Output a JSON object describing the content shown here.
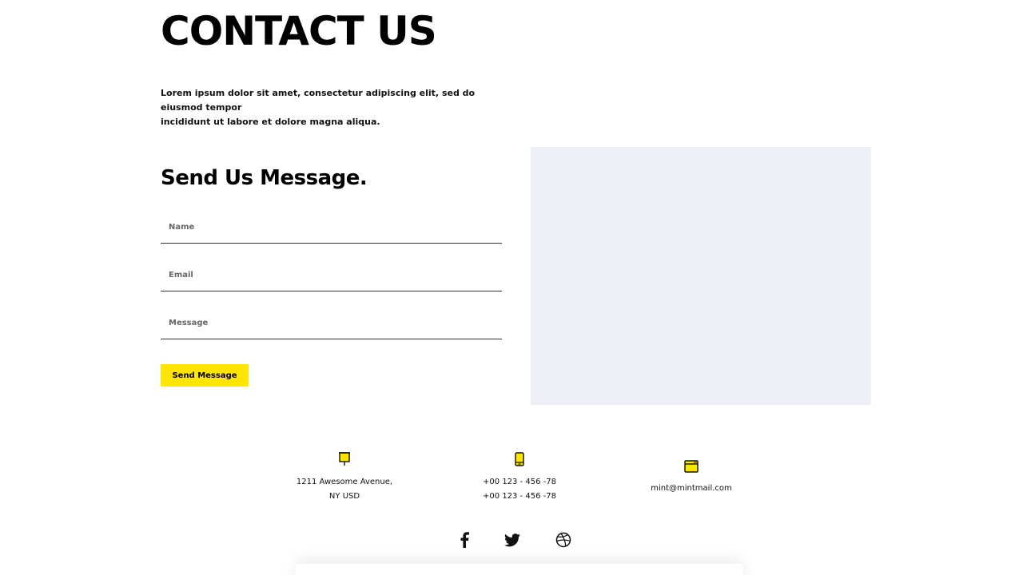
{
  "header": {
    "title": "CONTACT US",
    "intro_line1": "Lorem ipsum dolor sit amet, consectetur adipiscing elit, sed do eiusmod tempor",
    "intro_line2": "incididunt ut labore et dolore magna aliqua."
  },
  "form": {
    "heading": "Send Us Message.",
    "name_placeholder": "Name",
    "email_placeholder": "Email",
    "message_placeholder": "Message",
    "submit_label": "Send Message"
  },
  "contact_info": {
    "address_line1": "1211 Awesome Avenue,",
    "address_line2": "NY USD",
    "phone_line1": "+00 123 - 456 -78",
    "phone_line2": "+00 123 - 456 -78",
    "email": "mint@mintmail.com",
    "address_icon": "signpost-icon",
    "phone_icon": "mobile-phone-icon",
    "email_icon": "browser-window-icon"
  },
  "social": {
    "items": [
      "facebook-icon",
      "twitter-icon",
      "dribbble-icon"
    ]
  },
  "colors": {
    "accent": "#ffe500",
    "map_placeholder": "#edf1f5",
    "text": "#000000"
  }
}
